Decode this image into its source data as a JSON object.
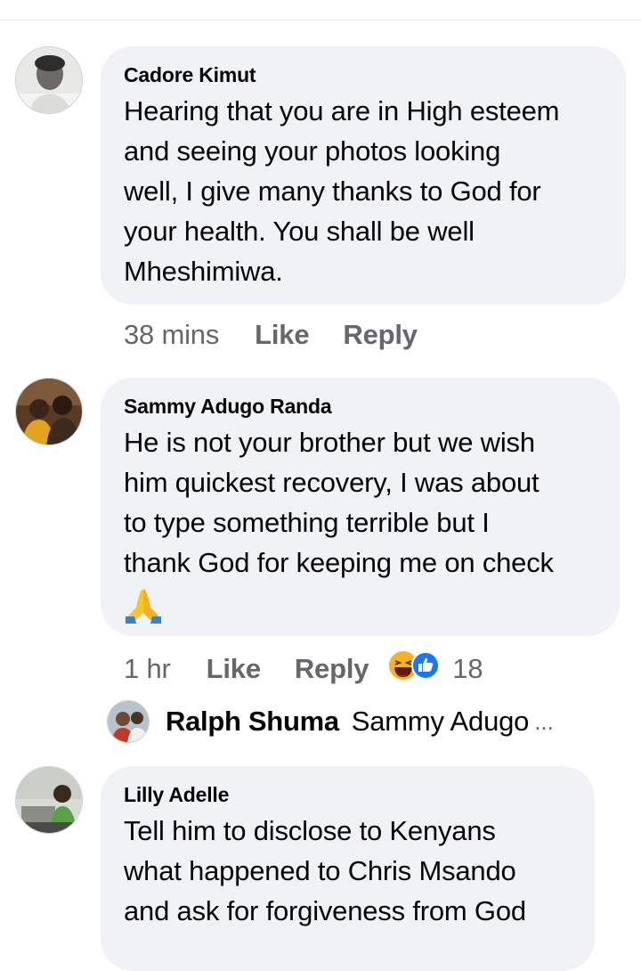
{
  "comments": [
    {
      "author": "Cadore Kimut",
      "lines": [
        "Hearing that you are in High esteem",
        "and seeing your photos looking",
        "well, I give many thanks to God for",
        "your health. You shall be well",
        "Mheshimiwa."
      ],
      "time": "38 mins",
      "like_label": "Like",
      "reply_label": "Reply"
    },
    {
      "author": "Sammy Adugo Randa",
      "lines": [
        "He is not your brother but we wish",
        "him quickest recovery, I was about",
        "to type something terrible but I",
        "thank God for keeping me on check"
      ],
      "emoji_icon": "folded-hands-emoji",
      "time": "1 hr",
      "like_label": "Like",
      "reply_label": "Reply",
      "reaction_icons": [
        "laughing-reaction-icon",
        "like-reaction-icon"
      ],
      "reaction_count": "18",
      "reply_preview": {
        "author": "Ralph Shuma",
        "text": "Sammy Adugo",
        "ellipsis": "..."
      }
    },
    {
      "author": "Lilly Adelle",
      "lines": [
        "Tell him to disclose to Kenyans",
        "what happened to Chris Msando",
        "and ask for forgiveness from God"
      ]
    }
  ],
  "colors": {
    "bubble_bg": "#f0f2f5",
    "text": "#050505",
    "meta_text": "#65676b",
    "like_blue": "#1877f2",
    "haha_yellow": "#f7b125"
  }
}
